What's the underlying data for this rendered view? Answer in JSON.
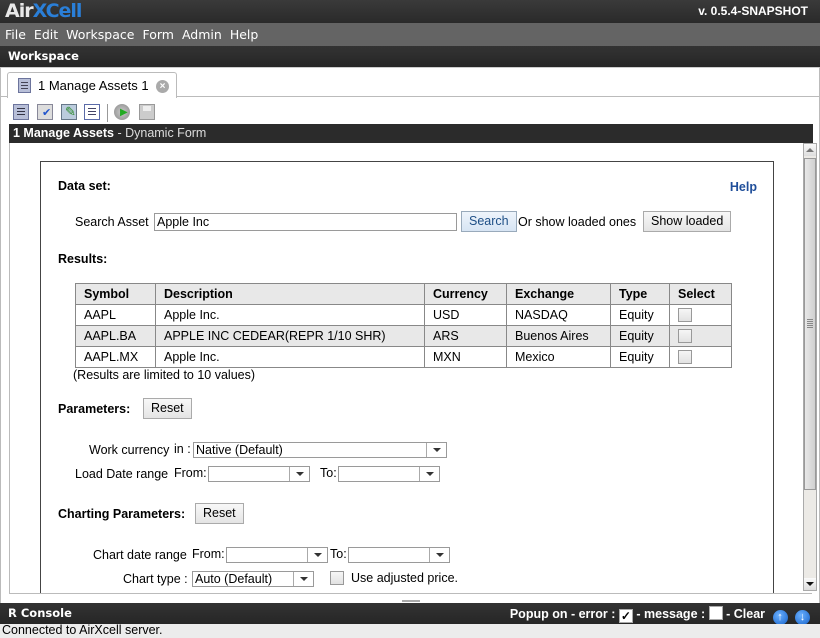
{
  "app": {
    "logo_part1": "Air",
    "logo_part2": "XCell",
    "version": "v. 0.5.4-SNAPSHOT"
  },
  "menu": [
    "File",
    "Edit",
    "Workspace",
    "Form",
    "Admin",
    "Help"
  ],
  "workspace_label": "Workspace",
  "tab": {
    "label": "1 Manage Assets 1"
  },
  "toolbar_icons": [
    "list-icon",
    "validate-icon",
    "edit-icon",
    "text-icon",
    "run-icon",
    "save-icon"
  ],
  "form_title": {
    "name": "1 Manage Assets",
    "suffix": " - Dynamic Form"
  },
  "form": {
    "dataset_label": "Data set:",
    "help_label": "Help",
    "search_asset_label": "Search Asset",
    "search_value": "Apple Inc",
    "search_button": "Search",
    "or_show_loaded": "Or show loaded ones",
    "show_loaded_button": "Show loaded",
    "results_label": "Results:",
    "results_table": {
      "headers": [
        "Symbol",
        "Description",
        "Currency",
        "Exchange",
        "Type",
        "Select"
      ],
      "rows": [
        [
          "AAPL",
          "Apple Inc.",
          "USD",
          "NASDAQ",
          "Equity"
        ],
        [
          "AAPL.BA",
          "APPLE INC CEDEAR(REPR 1/10 SHR)",
          "ARS",
          "Buenos Aires",
          "Equity"
        ],
        [
          "AAPL.MX",
          "Apple Inc.",
          "MXN",
          "Mexico",
          "Equity"
        ]
      ]
    },
    "results_note": "(Results are limited to 10 values)",
    "parameters_label": "Parameters:",
    "reset_label": "Reset",
    "work_currency_label": "Work currency",
    "in_label": "in :",
    "work_currency_value": "Native (Default)",
    "load_date_range_label": "Load Date range",
    "from_label": "From:",
    "to_label": "To:",
    "charting_parameters_label": "Charting Parameters:",
    "chart_date_range_label": "Chart date range",
    "chart_type_label": "Chart type :",
    "chart_type_value": "Auto (Default)",
    "use_adjusted_label": "Use adjusted price."
  },
  "console": {
    "title": "R Console",
    "popup_on_error": "Popup on - error :",
    "error_checked": "✓",
    "message_label": "- message :",
    "clear_label": "- Clear"
  },
  "status": "Connected to AirXcell server."
}
